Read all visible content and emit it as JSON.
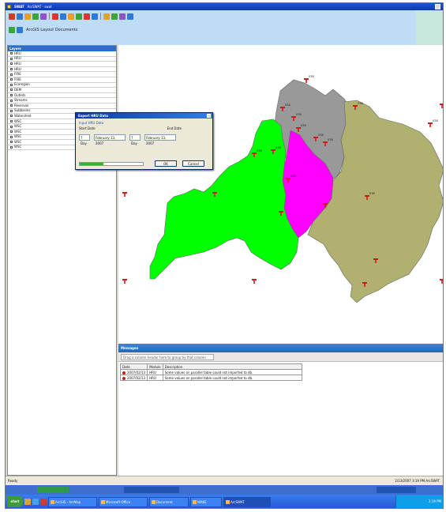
{
  "window": {
    "app_name": "SWAT",
    "title": "ArcSWAT - swat"
  },
  "toolbar": {
    "row2_label": "ArcGIS Layout Documents",
    "icon_colors": [
      "#d23a2a",
      "#2e7bd6",
      "#e0a22a",
      "#3aa53a",
      "#8c56c8",
      "#d23a2a",
      "#2e7bd6",
      "#e0a22a",
      "#3aa53a",
      "#d23a2a",
      "#2e7bd6",
      "#e0a22a",
      "#3aa53a",
      "#8c56c8",
      "#2e7bd6"
    ]
  },
  "left_panel": {
    "title": "Layers",
    "items": [
      "HRU",
      "HRU",
      "HRU",
      "HRU",
      "FIRE",
      "FIRE",
      "Ecoregion",
      "DEM",
      "Outlets",
      "Streams",
      "Reservoir",
      "Subbasins",
      "Watershed",
      "WSC",
      "WSC",
      "WSC",
      "WSC",
      "WSC",
      "WSC"
    ]
  },
  "dialog": {
    "title": "Export HRU Data",
    "group_label": "Input HRU Data",
    "col1": "Start Date",
    "col2": "End Date",
    "start_day": "7 Day",
    "start_month": "February  13, 2007",
    "end_day": "7 Day",
    "end_month": "February  13, 2007",
    "progress_fraction": 0.38,
    "ok_label": "OK",
    "cancel_label": "Cancel"
  },
  "map": {
    "colors": {
      "green_basin": "#00ff00",
      "magenta_basin": "#ff00ff",
      "gray_basin": "#999999",
      "olive_basin": "#b0b070",
      "marker_red": "#cc1b1b"
    },
    "labels": [
      "038",
      "038",
      "038",
      "038",
      "038",
      "038",
      "038",
      "038",
      "038",
      "038",
      "038",
      "038"
    ]
  },
  "bottom_panel": {
    "title": "Messages",
    "filter_placeholder": "Drag a column header here to group by that column",
    "columns": [
      "Date",
      "Module",
      "Description"
    ],
    "rows": [
      {
        "date": "2007/02/13",
        "module": "HRU",
        "description": "Some values on parallel table could not imported to db."
      },
      {
        "date": "2007/02/13",
        "module": "HRU",
        "description": "Some values on parallel table could not imported to db."
      }
    ]
  },
  "statusbar": {
    "left": "Ready",
    "right": "2/13/2007  3:19 PM  ArcSWAT"
  },
  "taskbar": {
    "start_label": "start",
    "tasks": [
      "ArcGIS - ArcMap",
      "Microsoft Office",
      "Document",
      "WAKE",
      "ArcSWAT"
    ],
    "clock": "3:19 PM"
  }
}
